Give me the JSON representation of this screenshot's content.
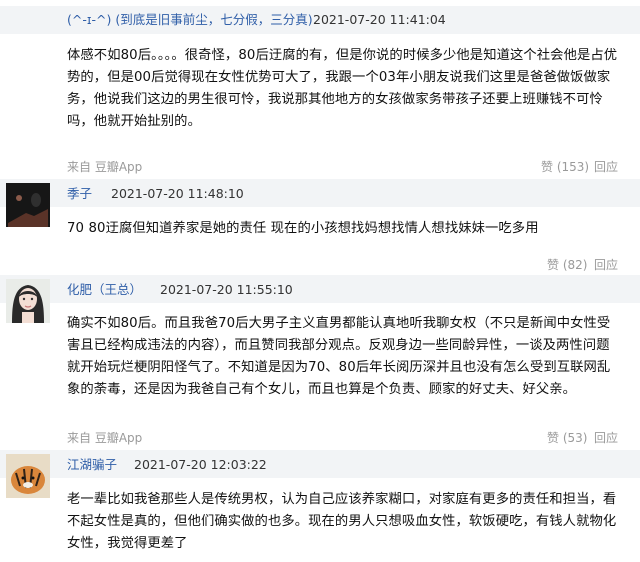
{
  "comments": [
    {
      "name": "(^-ɪ-^) (到底是旧事前尘，七分假，三分真)",
      "time": "2021-07-20 11:41:04",
      "body": "体感不如80后。。。。很奇怪，80后迂腐的有，但是你说的时候多少他是知道这个社会他是占优势的，但是00后觉得现在女性优势可大了，我跟一个03年小朋友说我们这里是爸爸做饭做家务，他说我们这边的男生很可怜，我说那其他地方的女孩做家务带孩子还要上班赚钱不可怜吗，他就开始扯别的。",
      "source": "来自 豆瓣App",
      "like": "赞 (153)",
      "reply": "回应"
    },
    {
      "name": "季子",
      "time": "2021-07-20 11:48:10",
      "body": "70 80迂腐但知道养家是她的责任 现在的小孩想找妈想找情人想找妹妹一吃多用",
      "like": "赞 (82)",
      "reply": "回应"
    },
    {
      "name": "化肥（王总）",
      "time": "2021-07-20 11:55:10",
      "body": "确实不如80后。而且我爸70后大男子主义直男都能认真地听我聊女权（不只是新闻中女性受害且已经构成违法的内容），而且赞同我部分观点。反观身边一些同龄异性，一谈及两性问题就开始玩烂梗阴阳怪气了。不知道是因为70、80后年长阅历深并且也没有怎么受到互联网乱象的荼毒，还是因为我爸自己有个女儿，而且也算是个负责、顾家的好丈夫、好父亲。",
      "source": "来自 豆瓣App",
      "like": "赞 (53)",
      "reply": "回应"
    },
    {
      "name": "江湖骗子",
      "time": "2021-07-20 12:03:22",
      "body": "老一辈比如我爸那些人是传统男权，认为自己应该养家糊口，对家庭有更多的责任和担当，看不起女性是真的，但他们确实做的也多。现在的男人只想吸血女性，软饭硬吃，有钱人就物化女性，我觉得更差了"
    }
  ],
  "icons": [
    "avatar-dark",
    "avatar-woman",
    "avatar-tiger"
  ]
}
